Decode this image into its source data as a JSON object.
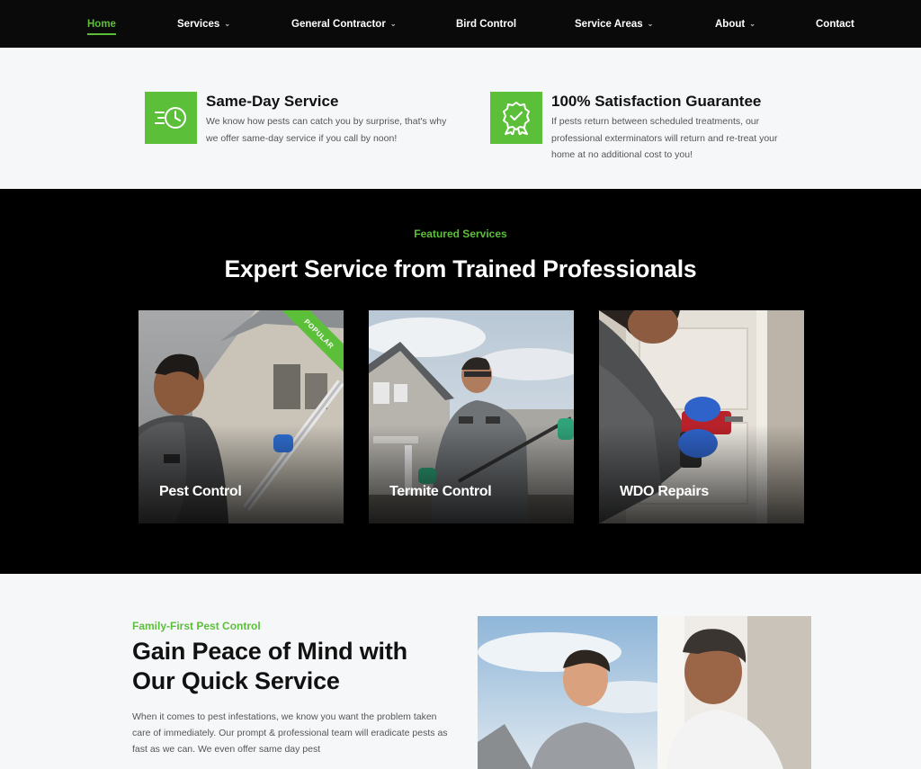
{
  "nav": {
    "items": [
      {
        "label": "Home",
        "chevron": false,
        "active": true
      },
      {
        "label": "Services",
        "chevron": true
      },
      {
        "label": "General Contractor",
        "chevron": true
      },
      {
        "label": "Bird Control",
        "chevron": false
      },
      {
        "label": "Service Areas",
        "chevron": true
      },
      {
        "label": "About",
        "chevron": true
      },
      {
        "label": "Contact",
        "chevron": false
      }
    ]
  },
  "features": [
    {
      "icon": "fast-clock-icon",
      "title": "Same-Day Service",
      "text": "We know how pests can catch you by surprise, that's why we offer same-day service if you call by noon!"
    },
    {
      "icon": "award-ribbon-icon",
      "title": "100% Satisfaction Guarantee",
      "text": "If pests return between scheduled treatments, our professional exterminators will return and re-treat your home at no additional cost to you!"
    }
  ],
  "featured": {
    "eyebrow": "Featured Services",
    "title": "Expert Service from Trained Professionals",
    "cards": [
      {
        "label": "Pest Control",
        "badge": "POPULAR"
      },
      {
        "label": "Termite Control"
      },
      {
        "label": "WDO Repairs"
      }
    ]
  },
  "about": {
    "eyebrow": "Family-First Pest Control",
    "title": "Gain Peace of Mind with Our Quick Service",
    "text": "When it comes to pest infestations, we know you want the problem taken care of immediately. Our prompt & professional team will eradicate pests as fast as we can. We even offer same day pest"
  },
  "colors": {
    "accent": "#5cbf3a",
    "dark": "#0a0a0a",
    "light_bg": "#f6f7f9"
  }
}
